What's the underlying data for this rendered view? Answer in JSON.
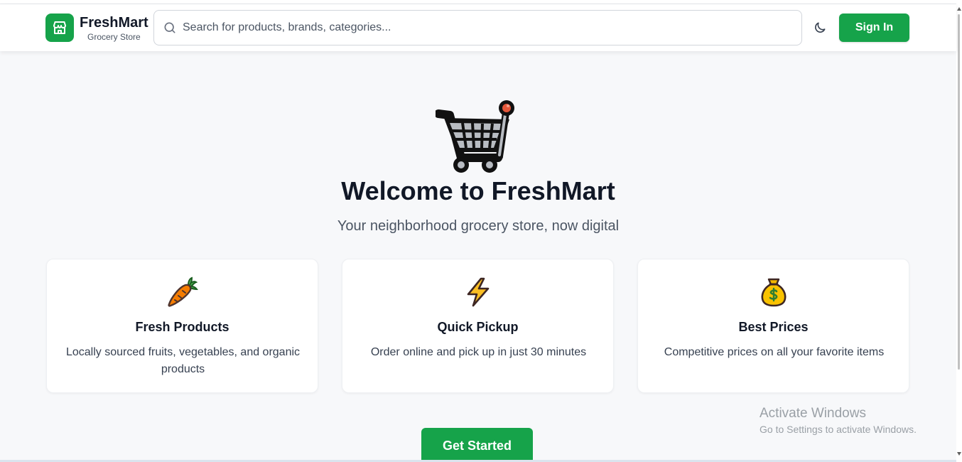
{
  "header": {
    "brand_name": "FreshMart",
    "brand_tagline": "Grocery Store",
    "search_placeholder": "Search for products, brands, categories...",
    "signin_label": "Sign In"
  },
  "hero": {
    "title": "Welcome to FreshMart",
    "subtitle": "Your neighborhood grocery store, now digital"
  },
  "features": [
    {
      "icon": "carrot-icon",
      "title": "Fresh Products",
      "description": "Locally sourced fruits, vegetables, and organic products"
    },
    {
      "icon": "lightning-icon",
      "title": "Quick Pickup",
      "description": "Order online and pick up in just 30 minutes"
    },
    {
      "icon": "money-bag-icon",
      "title": "Best Prices",
      "description": "Competitive prices on all your favorite items"
    }
  ],
  "cta": {
    "label": "Get Started"
  },
  "watermark": {
    "line1": "Activate Windows",
    "line2": "Go to Settings to activate Windows."
  },
  "colors": {
    "brand_green": "#16a34a",
    "background": "#f7f8fa",
    "text_dark": "#111827"
  }
}
